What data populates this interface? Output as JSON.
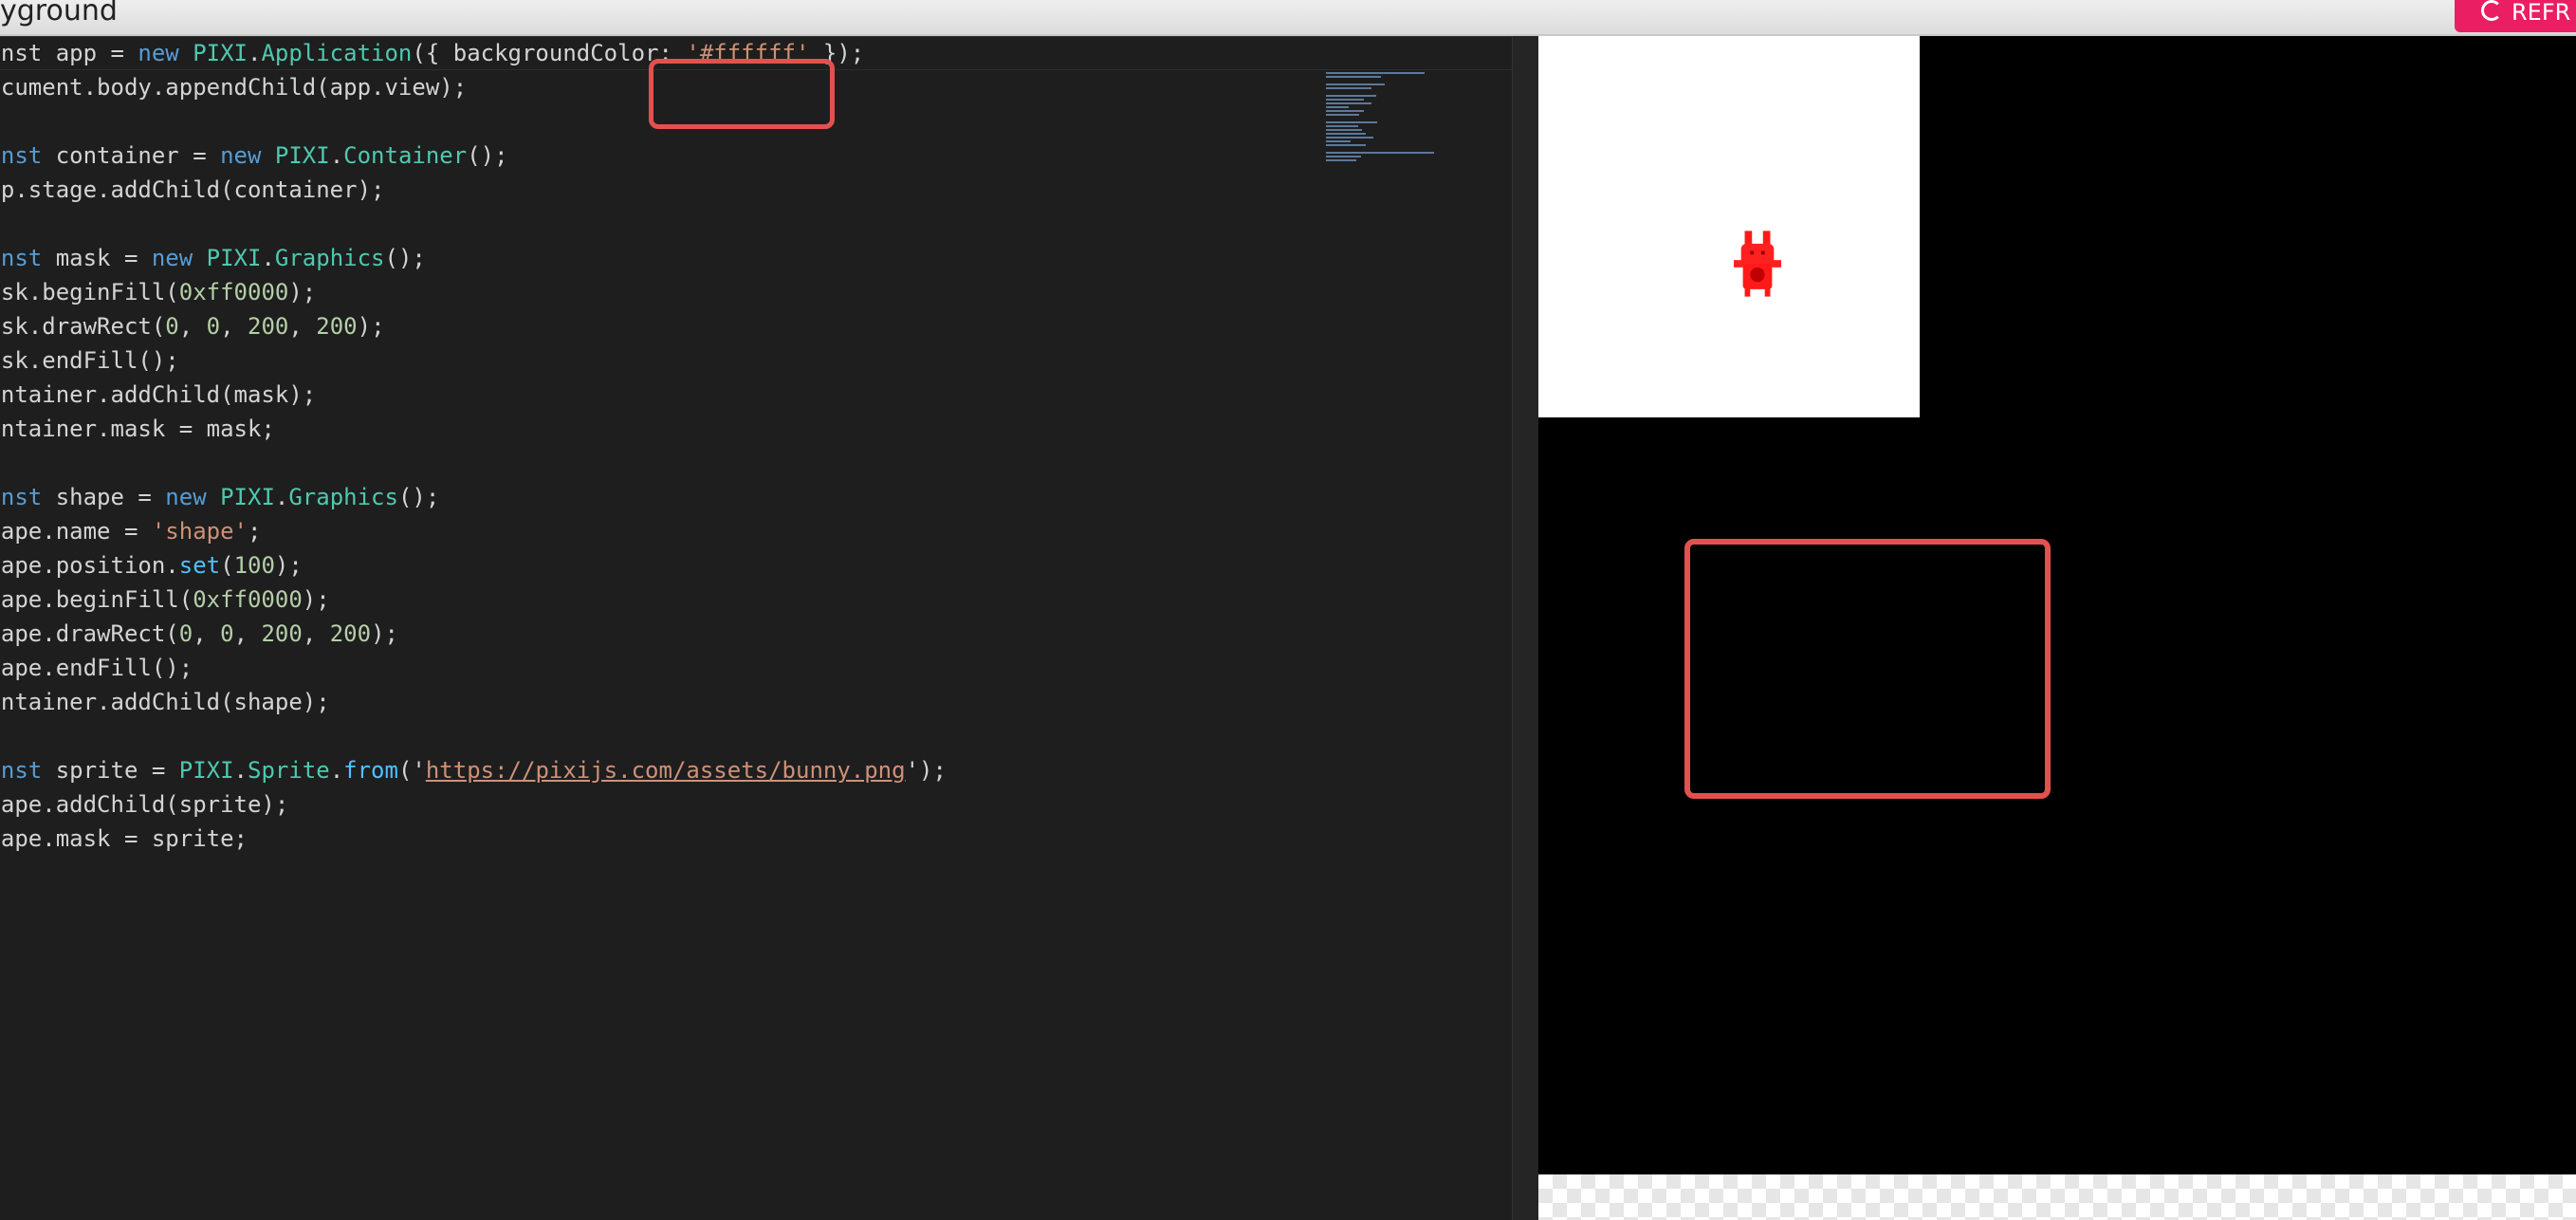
{
  "topbar": {
    "title": "yground",
    "refresh_label": "REFR"
  },
  "colors": {
    "accent": "#e91e63",
    "highlight": "#e2514f",
    "editor_bg": "#1e1e1e",
    "keyword": "#569cd6",
    "class": "#4ec9b0",
    "number": "#b5cea8",
    "string": "#ce9178"
  },
  "editor": {
    "lines": [
      [
        {
          "t": "const app = ",
          "c": ""
        },
        {
          "t": "new ",
          "c": "kw"
        },
        {
          "t": "PIXI",
          "c": "cls"
        },
        {
          "t": ".",
          "c": ""
        },
        {
          "t": "Application",
          "c": "cls"
        },
        {
          "t": "({ backgroundColor: ",
          "c": ""
        },
        {
          "t": "'#ffffff'",
          "c": "str"
        },
        {
          "t": " });",
          "c": ""
        }
      ],
      [
        {
          "t": "document.body.appendChild(app.view);",
          "c": ""
        }
      ],
      [],
      [
        {
          "t": "const ",
          "c": "kw"
        },
        {
          "t": "container = ",
          "c": ""
        },
        {
          "t": "new ",
          "c": "kw"
        },
        {
          "t": "PIXI",
          "c": "cls"
        },
        {
          "t": ".",
          "c": ""
        },
        {
          "t": "Container",
          "c": "cls"
        },
        {
          "t": "();",
          "c": ""
        }
      ],
      [
        {
          "t": "app.stage.addChild(container);",
          "c": ""
        }
      ],
      [],
      [
        {
          "t": "const ",
          "c": "kw"
        },
        {
          "t": "mask = ",
          "c": ""
        },
        {
          "t": "new ",
          "c": "kw"
        },
        {
          "t": "PIXI",
          "c": "cls"
        },
        {
          "t": ".",
          "c": ""
        },
        {
          "t": "Graphics",
          "c": "cls"
        },
        {
          "t": "();",
          "c": ""
        }
      ],
      [
        {
          "t": "mask.beginFill(",
          "c": ""
        },
        {
          "t": "0xff0000",
          "c": "num"
        },
        {
          "t": ");",
          "c": ""
        }
      ],
      [
        {
          "t": "mask.drawRect(",
          "c": ""
        },
        {
          "t": "0",
          "c": "num"
        },
        {
          "t": ", ",
          "c": ""
        },
        {
          "t": "0",
          "c": "num"
        },
        {
          "t": ", ",
          "c": ""
        },
        {
          "t": "200",
          "c": "num"
        },
        {
          "t": ", ",
          "c": ""
        },
        {
          "t": "200",
          "c": "num"
        },
        {
          "t": ");",
          "c": ""
        }
      ],
      [
        {
          "t": "mask.endFill();",
          "c": ""
        }
      ],
      [
        {
          "t": "container.addChild(mask);",
          "c": ""
        }
      ],
      [
        {
          "t": "container.mask = mask;",
          "c": ""
        }
      ],
      [],
      [
        {
          "t": "const ",
          "c": "kw"
        },
        {
          "t": "shape = ",
          "c": ""
        },
        {
          "t": "new ",
          "c": "kw"
        },
        {
          "t": "PIXI",
          "c": "cls"
        },
        {
          "t": ".",
          "c": ""
        },
        {
          "t": "Graphics",
          "c": "cls"
        },
        {
          "t": "();",
          "c": ""
        }
      ],
      [
        {
          "t": "shape.name = ",
          "c": ""
        },
        {
          "t": "'shape'",
          "c": "str"
        },
        {
          "t": ";",
          "c": ""
        }
      ],
      [
        {
          "t": "shape.position.",
          "c": ""
        },
        {
          "t": "set",
          "c": "fn"
        },
        {
          "t": "(",
          "c": ""
        },
        {
          "t": "100",
          "c": "num"
        },
        {
          "t": ");",
          "c": ""
        }
      ],
      [
        {
          "t": "shape.beginFill(",
          "c": ""
        },
        {
          "t": "0xff0000",
          "c": "num"
        },
        {
          "t": ");",
          "c": ""
        }
      ],
      [
        {
          "t": "shape.drawRect(",
          "c": ""
        },
        {
          "t": "0",
          "c": "num"
        },
        {
          "t": ", ",
          "c": ""
        },
        {
          "t": "0",
          "c": "num"
        },
        {
          "t": ", ",
          "c": ""
        },
        {
          "t": "200",
          "c": "num"
        },
        {
          "t": ", ",
          "c": ""
        },
        {
          "t": "200",
          "c": "num"
        },
        {
          "t": ");",
          "c": ""
        }
      ],
      [
        {
          "t": "shape.endFill();",
          "c": ""
        }
      ],
      [
        {
          "t": "container.addChild(shape);",
          "c": ""
        }
      ],
      [],
      [
        {
          "t": "const ",
          "c": "kw"
        },
        {
          "t": "sprite = ",
          "c": ""
        },
        {
          "t": "PIXI",
          "c": "cls"
        },
        {
          "t": ".",
          "c": ""
        },
        {
          "t": "Sprite",
          "c": "cls"
        },
        {
          "t": ".",
          "c": ""
        },
        {
          "t": "from",
          "c": "fn"
        },
        {
          "t": "('",
          "c": ""
        },
        {
          "t": "https://pixijs.com/assets/bunny.png",
          "c": "url"
        },
        {
          "t": "');",
          "c": ""
        }
      ],
      [
        {
          "t": "shape.addChild(sprite);",
          "c": ""
        }
      ],
      [
        {
          "t": "shape.mask = sprite;",
          "c": ""
        }
      ]
    ]
  },
  "preview": {
    "sprite_icon": "bunny-icon"
  }
}
